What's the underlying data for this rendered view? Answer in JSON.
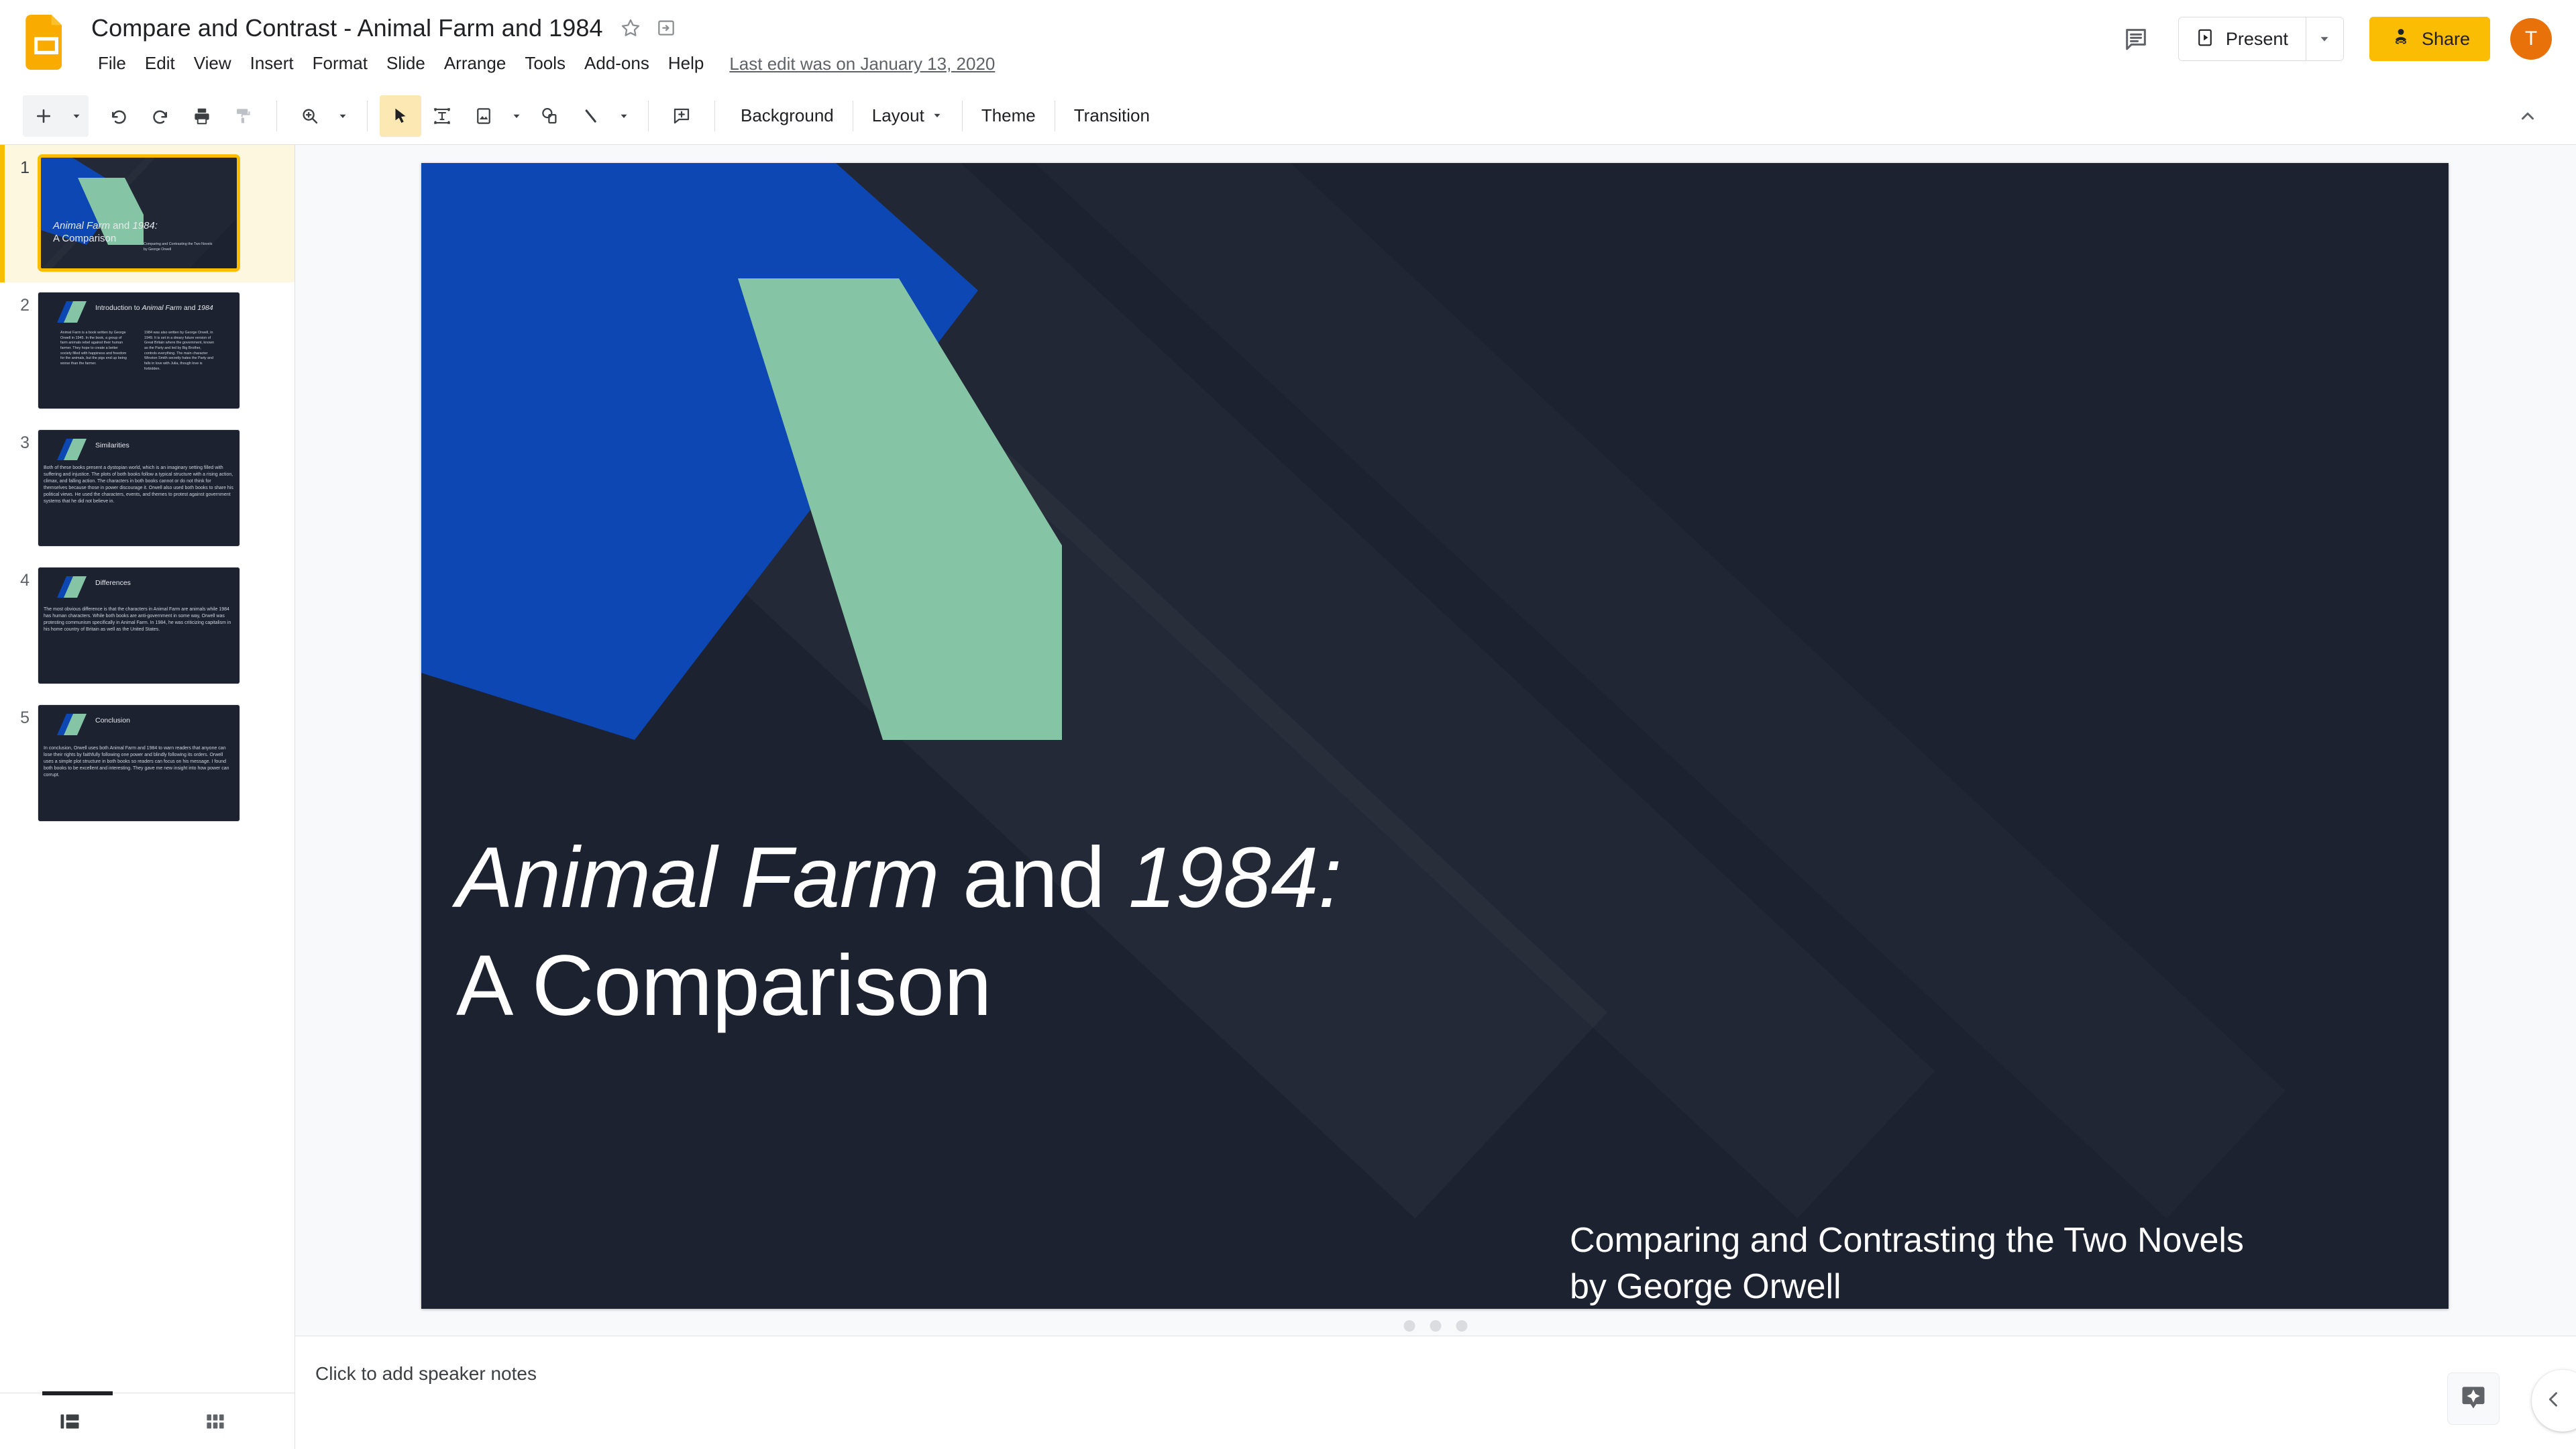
{
  "app": {
    "logo_icon": "google-slides-logo",
    "doc_title": "Compare and Contrast - Animal Farm and 1984",
    "star_icon": "star-outline-icon",
    "move_icon": "move-to-folder-icon",
    "last_edit": "Last edit was on January 13, 2020"
  },
  "menus": [
    {
      "label": "File"
    },
    {
      "label": "Edit"
    },
    {
      "label": "View"
    },
    {
      "label": "Insert"
    },
    {
      "label": "Format"
    },
    {
      "label": "Slide"
    },
    {
      "label": "Arrange"
    },
    {
      "label": "Tools"
    },
    {
      "label": "Add-ons"
    },
    {
      "label": "Help"
    }
  ],
  "header_actions": {
    "comment_icon": "comment-history-icon",
    "present_label": "Present",
    "present_icon": "present-screen-icon",
    "present_dropdown_icon": "chevron-down-icon",
    "share_label": "Share",
    "share_icon": "person-link-icon",
    "avatar_initial": "T",
    "avatar_color": "#e8710a",
    "share_color": "#fbbc04"
  },
  "toolbar": {
    "new_slide_icon": "plus-icon",
    "new_slide_caret_icon": "chevron-down-icon",
    "undo_icon": "undo-icon",
    "redo_icon": "redo-icon",
    "print_icon": "print-icon",
    "paint_icon": "paint-format-icon",
    "zoom_icon": "zoom-in-icon",
    "zoom_caret_icon": "chevron-down-icon",
    "select_icon": "cursor-arrow-icon",
    "textbox_icon": "text-box-icon",
    "image_icon": "insert-image-icon",
    "image_caret_icon": "chevron-down-icon",
    "shape_icon": "insert-shape-icon",
    "line_icon": "insert-line-icon",
    "line_caret_icon": "chevron-down-icon",
    "comment_icon": "add-comment-icon",
    "background_label": "Background",
    "layout_label": "Layout",
    "layout_caret_icon": "chevron-down-icon",
    "theme_label": "Theme",
    "transition_label": "Transition",
    "collapse_icon": "chevron-up-icon",
    "active_tool": "select"
  },
  "colors": {
    "slide_bg": "#1c2230",
    "accent_blue": "#0d47b3",
    "accent_green": "#85c4a4",
    "selection": "#fbbc04",
    "filmstrip_selected_bg": "#fef7e0"
  },
  "filmstrip": {
    "selected_index": 1,
    "slides": [
      {
        "number": "1",
        "layout": "title",
        "title_parts": [
          {
            "text": "Animal Farm",
            "italic": true
          },
          {
            "text": " and ",
            "italic": false
          },
          {
            "text": "1984:",
            "italic": true
          }
        ],
        "title_line2": "A Comparison",
        "subtitle": "Comparing and Contrasting the Two Novels\nby George Orwell"
      },
      {
        "number": "2",
        "layout": "two-column",
        "heading_parts": [
          {
            "text": "Introduction to ",
            "italic": false
          },
          {
            "text": "Animal Farm",
            "italic": true
          },
          {
            "text": " and ",
            "italic": false
          },
          {
            "text": "1984",
            "italic": true
          }
        ],
        "body_left": "Animal Farm is a book written by George Orwell in 1945. In the book, a group of farm animals rebel against their human farmer. They hope to create a better society filled with happiness and freedom for the animals, but the pigs end up being worse than the farmer.",
        "body_right": "1984 was also written by George Orwell, in 1949. It is set in a dreary future version of Great Britain where the government, known as the Party and led by Big Brother, controls everything. The main character Winston Smith secretly hates the Party and falls in love with Julia, though love is forbidden."
      },
      {
        "number": "3",
        "layout": "single",
        "heading": "Similarities",
        "body": "Both of these books present a dystopian world, which is an imaginary setting filled with suffering and injustice. The plots of both books follow a typical structure with a rising action, climax, and falling action. The characters in both books cannot or do not think for themselves because those in power discourage it. Orwell also used both books to share his political views. He used the characters, events, and themes to protest against government systems that he did not believe in."
      },
      {
        "number": "4",
        "layout": "single",
        "heading": "Differences",
        "body": "The most obvious difference is that the characters in Animal Farm are animals while 1984 has human characters. While both books are anti-government in some way, Orwell was protesting communism specifically in Animal Farm. In 1984, he was criticizing capitalism in his home country of Britain as well as the United States."
      },
      {
        "number": "5",
        "layout": "single",
        "heading": "Conclusion",
        "body": "In conclusion, Orwell uses both Animal Farm and 1984 to warn readers that anyone can lose their rights by faithfully following one power and blindly following its orders.  Orwell uses a simple plot structure in both books so readers can focus on his message. I found both books to be excellent and interesting. They gave me new insight into how power can corrupt."
      }
    ]
  },
  "main_slide": {
    "title_part_1": "Animal Farm",
    "title_part_2": " and ",
    "title_part_3": "1984:",
    "title_line_2": "A Comparison",
    "subtitle_line_1": "Comparing and Contrasting the Two Novels",
    "subtitle_line_2": "by George Orwell"
  },
  "notes": {
    "placeholder": "Click to add speaker notes"
  },
  "bottom_bar": {
    "filmstrip_view_icon": "filmstrip-view-icon",
    "grid_view_icon": "grid-view-icon",
    "explore_icon": "explore-sparkle-icon",
    "panel_toggle_icon": "chevron-left-icon"
  }
}
